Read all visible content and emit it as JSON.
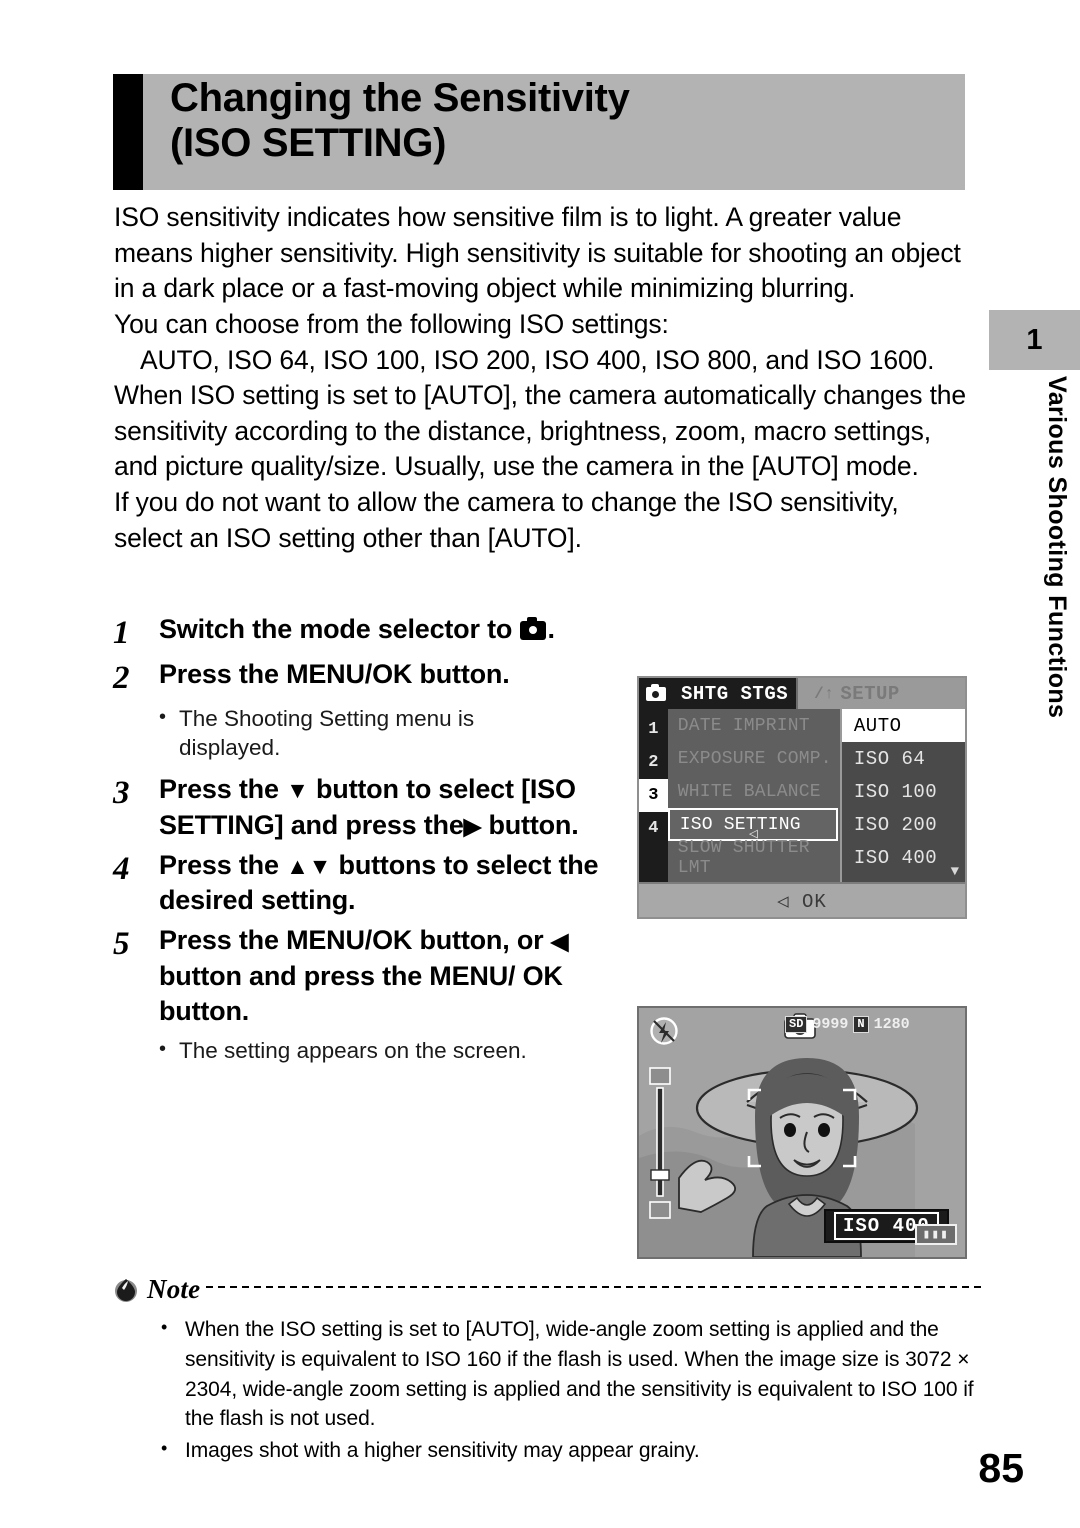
{
  "header": {
    "title_line1": "Changing the Sensitivity",
    "title_line2": "(ISO SETTING)"
  },
  "intro": {
    "p1": "ISO sensitivity indicates how sensitive film is to light. A greater value means higher sensitivity. High sensitivity is suitable for shooting an object in a dark place or a fast-moving object while minimizing blurring.",
    "p2": "You can choose from the following ISO settings:",
    "p3": "AUTO, ISO 64, ISO 100, ISO 200, ISO 400, ISO 800, and ISO 1600.",
    "p4": "When ISO setting is set to [AUTO], the camera automatically changes the sensitivity according to the distance, brightness, zoom, macro settings, and picture quality/size. Usually, use the camera in the [AUTO] mode.",
    "p5": "If you do not want to allow the camera to change the ISO sensitivity, select an ISO setting other than [AUTO]."
  },
  "steps": [
    {
      "num": "1",
      "text_before": "Switch the mode selector to",
      "icon": "camera-icon",
      "text_after": "."
    },
    {
      "num": "2",
      "text_before": "Press the MENU/OK button.",
      "bullet": "The Shooting Setting menu is displayed."
    },
    {
      "num": "3",
      "text_before": "Press the",
      "icon": "▼",
      "text_after": "button to select [ISO SETTING] and press the",
      "icon2": "▶",
      "text_after2": "button."
    },
    {
      "num": "4",
      "text_before": "Press the",
      "icon": "▲▼",
      "text_after": "buttons to select the desired setting."
    },
    {
      "num": "5",
      "text_before": "Press the MENU/OK button, or",
      "icon": "◀",
      "text_after": "button and press the MENU/ OK button.",
      "bullet": "The setting appears on the screen."
    }
  ],
  "sidebar": {
    "chapter_number": "1",
    "chapter_title": "Various Shooting Functions"
  },
  "lcd_menu": {
    "tab_active": "SHTG STGS",
    "tab_inactive": "SETUP",
    "indices": [
      "1",
      "2",
      "3",
      "4"
    ],
    "selected_index": "3",
    "items": [
      "DATE IMPRINT",
      "EXPOSURE COMP.",
      "WHITE BALANCE",
      "ISO SETTING",
      "SLOW SHUTTER LMT"
    ],
    "highlighted_item": "ISO SETTING",
    "values": [
      "AUTO",
      "ISO 64",
      "ISO 100",
      "ISO 200",
      "ISO 400"
    ],
    "selected_value": "AUTO",
    "footer": "OK",
    "footer_arrow": "◁",
    "scroll_arrow": "▼",
    "caret": "◁"
  },
  "lcd_photo": {
    "card_badge": "SD",
    "shots_remaining": "9999",
    "quality_badge": "N",
    "image_size": "1280",
    "iso_display": "ISO 400",
    "battery": "battery-icon",
    "flash_icon": "flash-off-icon",
    "mode_icon": "camera-icon"
  },
  "note": {
    "label": "Note",
    "items": [
      "When the ISO setting is set to [AUTO], wide-angle zoom setting is applied and the sensitivity is equivalent to ISO 160 if the flash is used. When the image size is 3072 × 2304, wide-angle zoom setting is applied and the sensitivity is equivalent to ISO 100 if the flash is not used.",
      "Images shot with a higher sensitivity may appear grainy."
    ]
  },
  "footer": {
    "page_number": "85"
  },
  "colors": {
    "header_band": "#b3b3b3",
    "rule": "#000000",
    "lcd_dark": "#3b3b3b",
    "lcd_light": "#9d9d9d"
  }
}
